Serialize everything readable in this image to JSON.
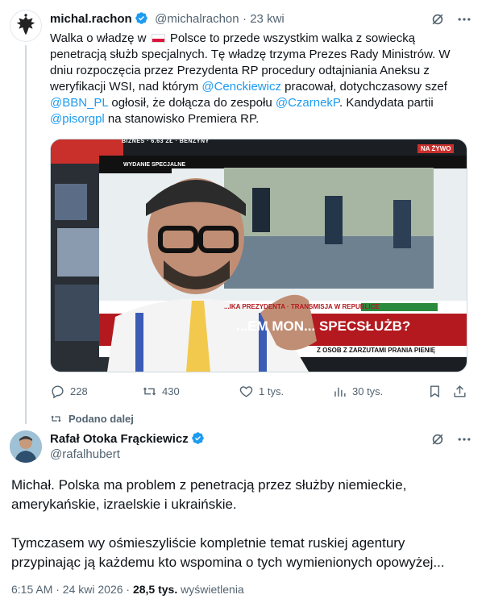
{
  "tweet1": {
    "display_name": "michal.rachon",
    "handle": "@michalrachon",
    "time": "23 kwi",
    "text_before_flag": "Walka o władzę w ",
    "text_after_flag": " Polsce to przede wszystkim walka z sowiecką penetracją służb specjalnych. Tę władzę trzyma Prezes Rady Ministrów. W dniu rozpoczęcia przez Prezydenta RP procedury odtajniania Aneksu z weryfikacji WSI, nad którym ",
    "mention1": "@Cenckiewicz",
    "text_mid1": " pracował, dotychczasowy szef ",
    "mention2": "@BBN_PL",
    "text_mid2": "  ogłosił, że dołącza do zespołu ",
    "mention3": "@CzarnekP",
    "text_mid3": ". Kandydata partii ",
    "mention4": "@pisorgpl",
    "text_end": " na stanowisko Premiera RP.",
    "media": {
      "overlay_banner": "WYDANIE SPECJALNE",
      "overlay_headline": "...EM MON... SPECSŁUŻB?",
      "overlay_ticker": "...IKA PREZYDENTA · TRANSMISJA W REPUBLICE",
      "overlay_ticker2": "Z OSOB Z ZARZUTAMI PRANIA PIENIĘ",
      "overlay_live": "NA ŻYWO",
      "overlay_top": "BIZNES · 6.63 ZŁ · BENZYNY"
    },
    "actions": {
      "replies": "228",
      "reposts": "430",
      "likes": "1 tys.",
      "views": "30 tys."
    }
  },
  "repost_label": "Podano dalej",
  "tweet2": {
    "display_name": "Rafał Otoka Frąckiewicz",
    "handle": "@rafalhubert",
    "paragraph1": "Michał. Polska ma problem z penetracją przez służby niemieckie, amerykańskie, izraelskie i ukraińskie.",
    "paragraph2": "Tymczasem wy ośmieszyliście kompletnie temat ruskiej agentury przypinając ją każdemu kto wspomina o tych wymienionych opowyżej...",
    "timestamp": "6:15 AM · 24 kwi 2026 · ",
    "views_count": "28,5 tys.",
    "views_label": " wyświetlenia"
  },
  "colors": {
    "accent": "#1d9bf0",
    "muted": "#536471"
  }
}
